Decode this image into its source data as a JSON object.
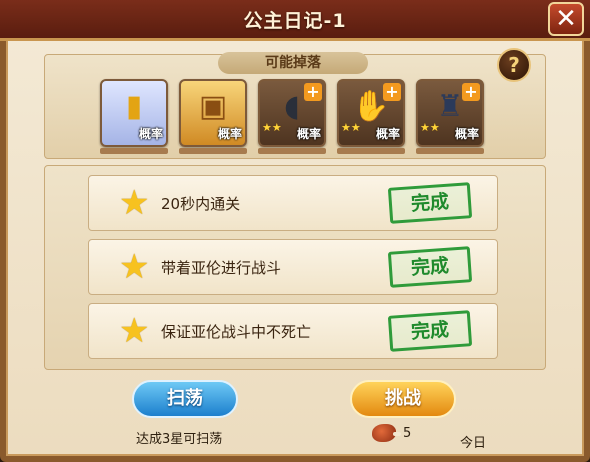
{
  "window": {
    "title": "公主日记-1",
    "close_label": "✕"
  },
  "drops": {
    "label": "可能掉落",
    "help_label": "?",
    "items": [
      {
        "icon": "gold-coin-icon",
        "rate_label": "概率"
      },
      {
        "icon": "treasure-chest-icon",
        "rate_label": "概率",
        "badge": ""
      },
      {
        "icon": "gauntlet-armor-icon",
        "rate_label": "概率",
        "badge": "+",
        "stars": "★★"
      },
      {
        "icon": "leather-glove-icon",
        "rate_label": "概率",
        "badge": "+",
        "stars": "★★"
      },
      {
        "icon": "dark-armor-icon",
        "rate_label": "概率",
        "badge": "+",
        "stars": "★★"
      }
    ]
  },
  "tasks": [
    {
      "text": "20秒内通关",
      "status": "完成"
    },
    {
      "text": "带着亚伦进行战斗",
      "status": "完成"
    },
    {
      "text": "保证亚伦战斗中不死亡",
      "status": "完成"
    }
  ],
  "actions": {
    "sweep_label": "扫荡",
    "challenge_label": "挑战",
    "sweep_hint": "达成3星可扫荡",
    "stamina_cost": "5",
    "today_label": "今日"
  },
  "colors": {
    "accent_frame": "#8a5a2c",
    "title_bar": "#7a2d1a",
    "stamp_green": "#2f9b3a"
  }
}
